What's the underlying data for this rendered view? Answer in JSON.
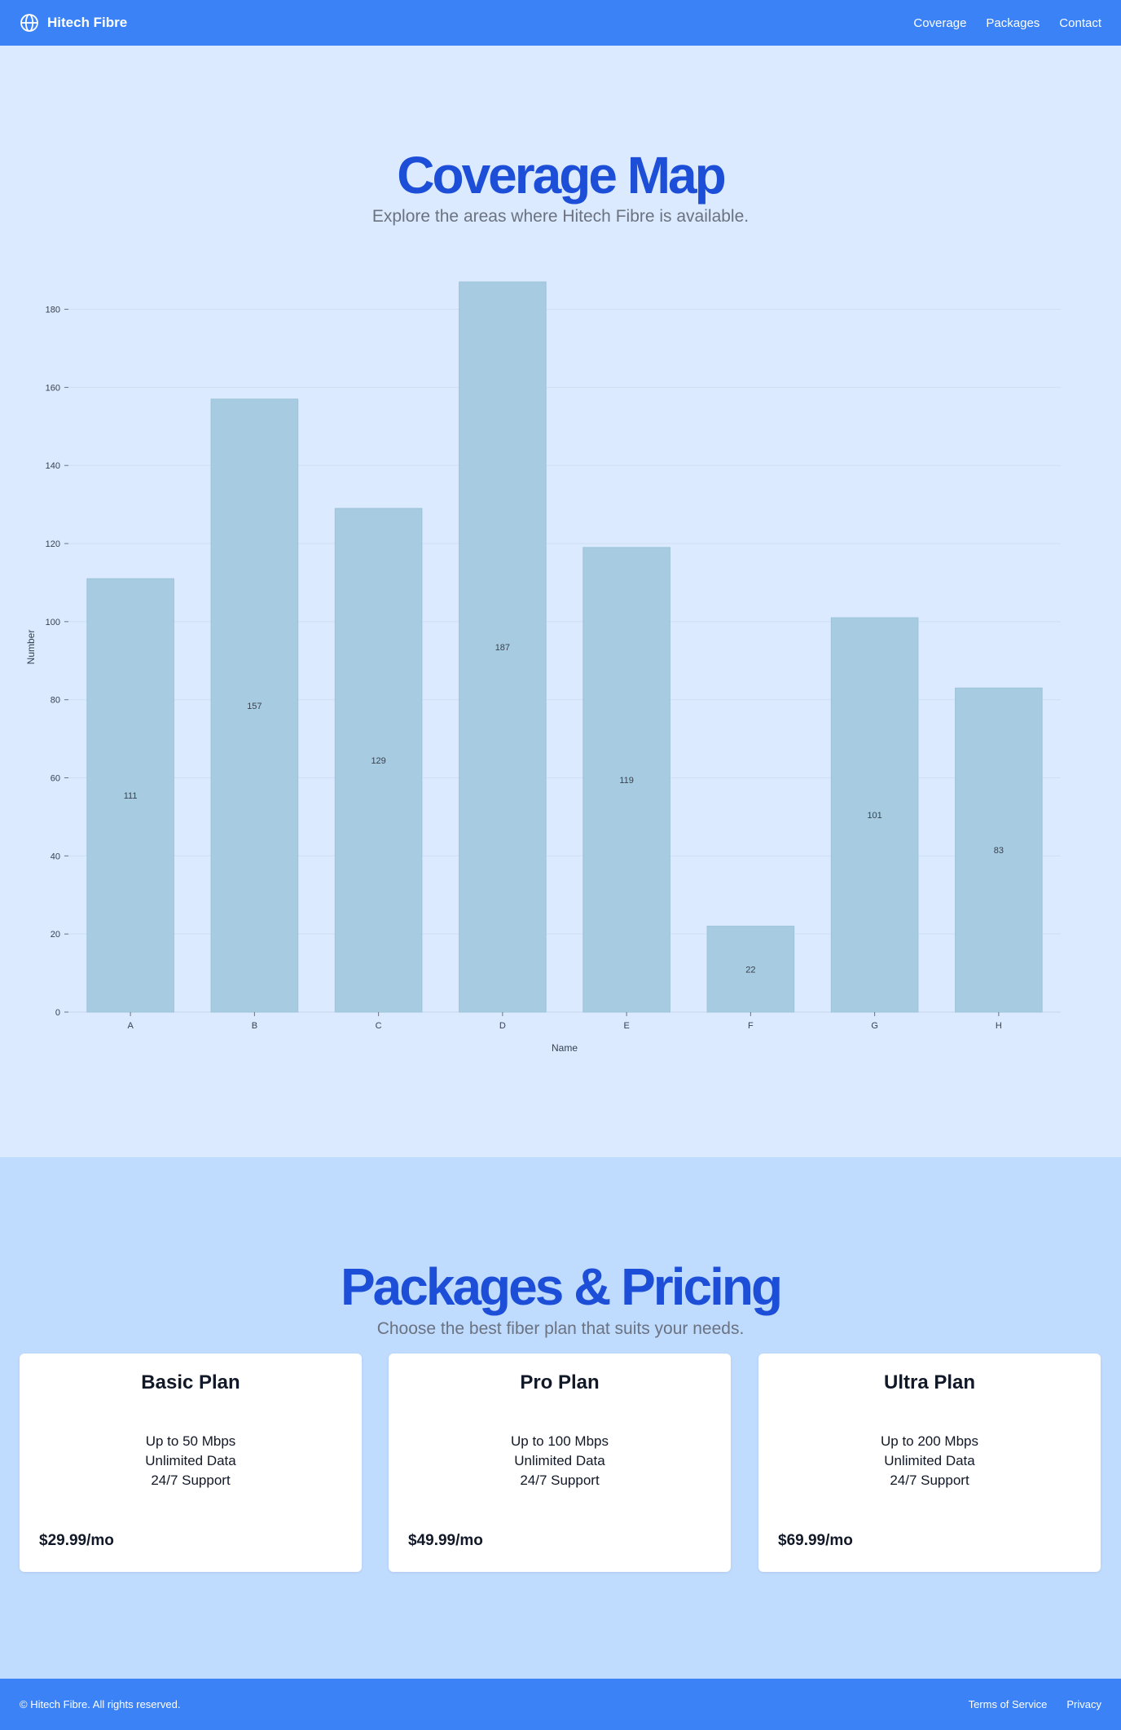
{
  "header": {
    "brand": "Hitech Fibre",
    "nav": [
      "Coverage",
      "Packages",
      "Contact"
    ]
  },
  "coverage": {
    "title": "Coverage Map",
    "subtitle": "Explore the areas where Hitech Fibre is available."
  },
  "chart_data": {
    "type": "bar",
    "categories": [
      "A",
      "B",
      "C",
      "D",
      "E",
      "F",
      "G",
      "H"
    ],
    "values": [
      111,
      157,
      129,
      187,
      119,
      22,
      101,
      83
    ],
    "xlabel": "Name",
    "ylabel": "Number",
    "ylim": [
      0,
      187
    ],
    "yticks": [
      0,
      20,
      40,
      60,
      80,
      100,
      120,
      140,
      160,
      180
    ],
    "grid": true,
    "data_labels": true,
    "colors": {
      "bar": "#a7cce1",
      "grid": "#cfdef4",
      "axis_text": "#374151"
    }
  },
  "pricing": {
    "title": "Packages & Pricing",
    "subtitle": "Choose the best fiber plan that suits your needs.",
    "plans": [
      {
        "name": "Basic Plan",
        "features": [
          "Up to 50 Mbps",
          "Unlimited Data",
          "24/7 Support"
        ],
        "price": "$29.99/mo"
      },
      {
        "name": "Pro Plan",
        "features": [
          "Up to 100 Mbps",
          "Unlimited Data",
          "24/7 Support"
        ],
        "price": "$49.99/mo"
      },
      {
        "name": "Ultra Plan",
        "features": [
          "Up to 200 Mbps",
          "Unlimited Data",
          "24/7 Support"
        ],
        "price": "$69.99/mo"
      }
    ]
  },
  "footer": {
    "copyright": "© Hitech Fibre. All rights reserved.",
    "links": [
      "Terms of Service",
      "Privacy"
    ]
  },
  "colors": {
    "header": "#3b82f6",
    "page_bg": "#dbeafe",
    "pricing_bg": "#bfdbfe",
    "heading": "#1d4ed8",
    "subtext": "#6b7280"
  },
  "icons": {
    "brand": "globe-icon"
  }
}
